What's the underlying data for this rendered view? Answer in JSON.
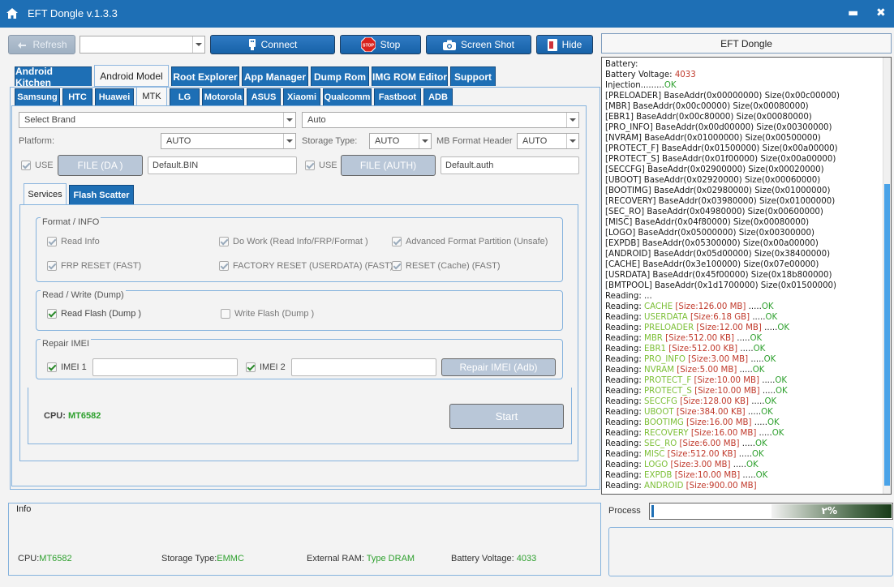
{
  "window": {
    "title": "EFT Dongle  v.1.3.3",
    "minimize": "▬",
    "close": "✖"
  },
  "toolbar": {
    "refresh": "Refresh",
    "port_select": "",
    "connect": "Connect",
    "stop": "Stop",
    "stop_badge": "STOP",
    "screenshot": "Screen Shot",
    "hide": "Hide"
  },
  "main_tabs": [
    "Android Kitchen",
    "Android Model",
    "Root Explorer",
    "App Manager",
    "Dump Rom",
    "IMG ROM Editor",
    "Support"
  ],
  "brand_tabs": [
    "Samsung",
    "HTC",
    "Huawei",
    "MTK",
    "LG",
    "Motorola",
    "ASUS",
    "Xiaomi",
    "Qualcomm",
    "Fastboot",
    "ADB"
  ],
  "mtk": {
    "brand_placeholder": "Select Brand",
    "model_value": "Auto",
    "platform_label": "Platform:",
    "platform_value": "AUTO",
    "storage_label": "Storage Type:",
    "storage_value": "AUTO",
    "mb_label": "MB Format Header",
    "mb_value": "AUTO",
    "use1": "USE",
    "file_da": "FILE (DA )",
    "da_value": "Default.BIN",
    "use2": "USE",
    "file_auth": "FILE (AUTH)",
    "auth_value": "Default.auth"
  },
  "sub_tabs": [
    "Services",
    "Flash Scatter"
  ],
  "format_group": {
    "title": "Format / INFO",
    "items": [
      "Read Info",
      "Do Work (Read Info/FRP/Format )",
      "Advanced Format Partition (Unsafe)",
      "FRP RESET (FAST)",
      "FACTORY RESET (USERDATA) (FAST)",
      "RESET (Cache) (FAST)"
    ]
  },
  "rw_group": {
    "title": "Read / Write (Dump)",
    "read": "Read Flash (Dump )",
    "write": "Write Flash (Dump )"
  },
  "imei_group": {
    "title": "Repair IMEI",
    "imei1": "IMEI 1",
    "imei2": "IMEI 2",
    "repair": "Repair IMEI (Adb)"
  },
  "cpu": {
    "label": "CPU:",
    "value": "MT6582"
  },
  "start": "Start",
  "log_title": "EFT Dongle",
  "log": {
    "battery": "Battery:",
    "voltage_label": "Battery Voltage: ",
    "voltage_value": "4033",
    "injection": "Injection.........",
    "injection_ok": "OK",
    "partitions": [
      "[PRELOADER] BaseAddr(0x00000000) Size(0x00c00000)",
      "[MBR] BaseAddr(0x00c00000) Size(0x00080000)",
      "[EBR1] BaseAddr(0x00c80000) Size(0x00080000)",
      "[PRO_INFO] BaseAddr(0x00d00000) Size(0x00300000)",
      "[NVRAM] BaseAddr(0x01000000) Size(0x00500000)",
      "[PROTECT_F] BaseAddr(0x01500000) Size(0x00a00000)",
      "[PROTECT_S] BaseAddr(0x01f00000) Size(0x00a00000)",
      "[SECCFG] BaseAddr(0x02900000) Size(0x00020000)",
      "[UBOOT] BaseAddr(0x02920000) Size(0x00060000)",
      "[BOOTIMG] BaseAddr(0x02980000) Size(0x01000000)",
      "[RECOVERY] BaseAddr(0x03980000) Size(0x01000000)",
      "[SEC_RO] BaseAddr(0x04980000) Size(0x00600000)",
      "[MISC] BaseAddr(0x04f80000) Size(0x00080000)",
      "[LOGO] BaseAddr(0x05000000) Size(0x00300000)",
      "[EXPDB] BaseAddr(0x05300000) Size(0x00a00000)",
      "[ANDROID] BaseAddr(0x05d00000) Size(0x38400000)",
      "[CACHE] BaseAddr(0x3e100000) Size(0x07e00000)",
      "[USRDATA] BaseAddr(0x45f00000) Size(0x18b800000)",
      "[BMTPOOL] BaseAddr(0x1d1700000) Size(0x01500000)"
    ],
    "reading_start": "Reading: ...",
    "reading_prefix": "Reading: ",
    "reads": [
      {
        "name": "CACHE",
        "size": "[Size:126.00 MB]",
        "dots": " .....",
        "ok": "OK"
      },
      {
        "name": "USERDATA",
        "size": "[Size:6.18 GB]",
        "dots": " .....",
        "ok": "OK"
      },
      {
        "name": "PRELOADER",
        "size": "[Size:12.00 MB]",
        "dots": " .....",
        "ok": "OK"
      },
      {
        "name": "MBR",
        "size": "[Size:512.00 KB]",
        "dots": " .....",
        "ok": "OK"
      },
      {
        "name": "EBR1",
        "size": "[Size:512.00 KB]",
        "dots": " .....",
        "ok": "OK"
      },
      {
        "name": "PRO_INFO",
        "size": "[Size:3.00 MB]",
        "dots": " .....",
        "ok": "OK"
      },
      {
        "name": "NVRAM",
        "size": "[Size:5.00 MB]",
        "dots": " .....",
        "ok": "OK"
      },
      {
        "name": "PROTECT_F",
        "size": "[Size:10.00 MB]",
        "dots": " .....",
        "ok": "OK"
      },
      {
        "name": "PROTECT_S",
        "size": "[Size:10.00 MB]",
        "dots": " .....",
        "ok": "OK"
      },
      {
        "name": "SECCFG",
        "size": "[Size:128.00 KB]",
        "dots": " .....",
        "ok": "OK"
      },
      {
        "name": "UBOOT",
        "size": "[Size:384.00 KB]",
        "dots": " .....",
        "ok": "OK"
      },
      {
        "name": "BOOTIMG",
        "size": "[Size:16.00 MB]",
        "dots": " .....",
        "ok": "OK"
      },
      {
        "name": "RECOVERY",
        "size": "[Size:16.00 MB]",
        "dots": " .....",
        "ok": "OK"
      },
      {
        "name": "SEC_RO",
        "size": "[Size:6.00 MB]",
        "dots": " .....",
        "ok": "OK"
      },
      {
        "name": "MISC",
        "size": "[Size:512.00 KB]",
        "dots": " .....",
        "ok": "OK"
      },
      {
        "name": "LOGO",
        "size": "[Size:3.00 MB]",
        "dots": " .....",
        "ok": "OK"
      },
      {
        "name": "EXPDB",
        "size": "[Size:10.00 MB]",
        "dots": " .....",
        "ok": "OK"
      },
      {
        "name": "ANDROID",
        "size": "[Size:900.00 MB]",
        "dots": "",
        "ok": ""
      }
    ]
  },
  "info": {
    "title": "Info",
    "cpu_label": "CPU:",
    "cpu_value": "MT6582",
    "storage_label": "Storage Type:",
    "storage_value": "EMMC",
    "ram_label": "External RAM: ",
    "ram_value": "Type DRAM",
    "battery_label": "Battery Voltage: ",
    "battery_value": "4033"
  },
  "process": {
    "label": "Process",
    "percent_text": "٢%",
    "progress": 0.02
  },
  "colors": {
    "accent": "#1e6fb5",
    "ok": "#2ea02e",
    "value_red": "#c0392b",
    "partition_green": "#7cbf36"
  }
}
